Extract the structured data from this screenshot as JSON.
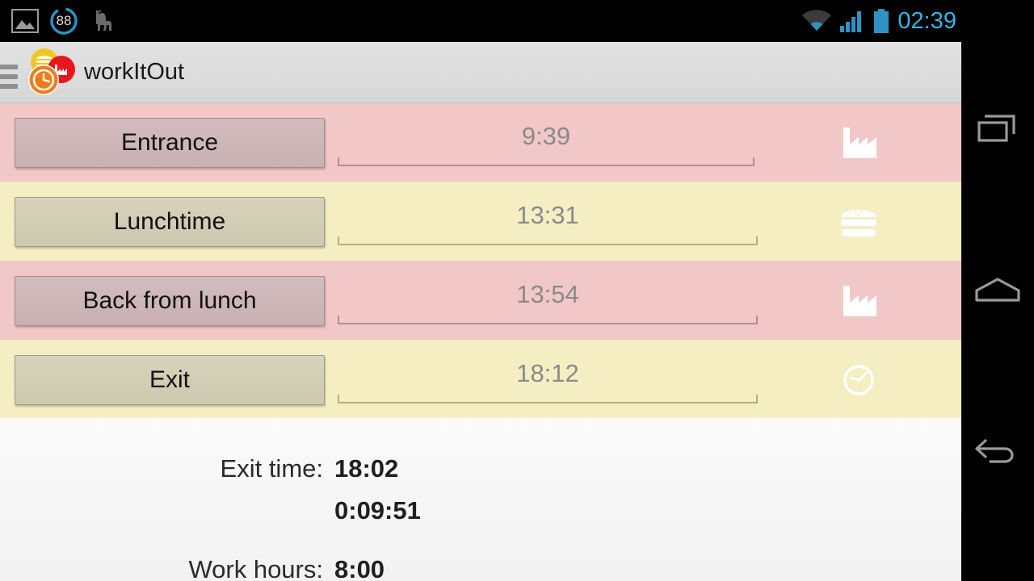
{
  "statusbar": {
    "left_icons": [
      {
        "name": "gallery-image-icon",
        "label": "image"
      },
      {
        "name": "notification-count-badge",
        "label": "88"
      },
      {
        "name": "llama-icon",
        "label": "llama"
      }
    ],
    "right_icons": [
      {
        "name": "wifi-icon",
        "label": "wifi"
      },
      {
        "name": "cellular-signal-icon",
        "label": "signal"
      },
      {
        "name": "battery-icon",
        "label": "battery"
      }
    ],
    "notification_count": "88",
    "clock": "02:39",
    "clock_color": "#33b5e5"
  },
  "actionbar": {
    "title": "workItOut",
    "drawer_icon": "hamburger-menu-icon",
    "logo_icon": "app-logo-icon",
    "background_color": "#dcdcdc"
  },
  "rows": [
    {
      "label": "Entrance",
      "time": "9:39",
      "time_placeholder": "--:--",
      "icon": "factory-icon",
      "row_color": "#f2c7c7",
      "button_color": "#cdb3b6",
      "tone": "pink"
    },
    {
      "label": "Lunchtime",
      "time": "13:31",
      "time_placeholder": "--:--",
      "icon": "burger-icon",
      "row_color": "#f4eec2",
      "button_color": "#d2cfb6",
      "tone": "yellow"
    },
    {
      "label": "Back from lunch",
      "time": "13:54",
      "time_placeholder": "--:--",
      "icon": "factory-icon",
      "row_color": "#f2c7c7",
      "button_color": "#cdb3b6",
      "tone": "pink"
    },
    {
      "label": "Exit",
      "time": "18:12",
      "time_placeholder": "--:--",
      "icon": "clock-icon",
      "row_color": "#f4eec2",
      "button_color": "#d2cfb6",
      "tone": "yellow"
    }
  ],
  "summary": {
    "exit_time_label": "Exit time:",
    "exit_time_value": "18:02",
    "countdown_value": "0:09:51",
    "work_hours_label": "Work hours:",
    "work_hours_value": "8:00"
  },
  "navbar": {
    "recent_label": "Recent apps",
    "home_label": "Home",
    "back_label": "Back"
  }
}
